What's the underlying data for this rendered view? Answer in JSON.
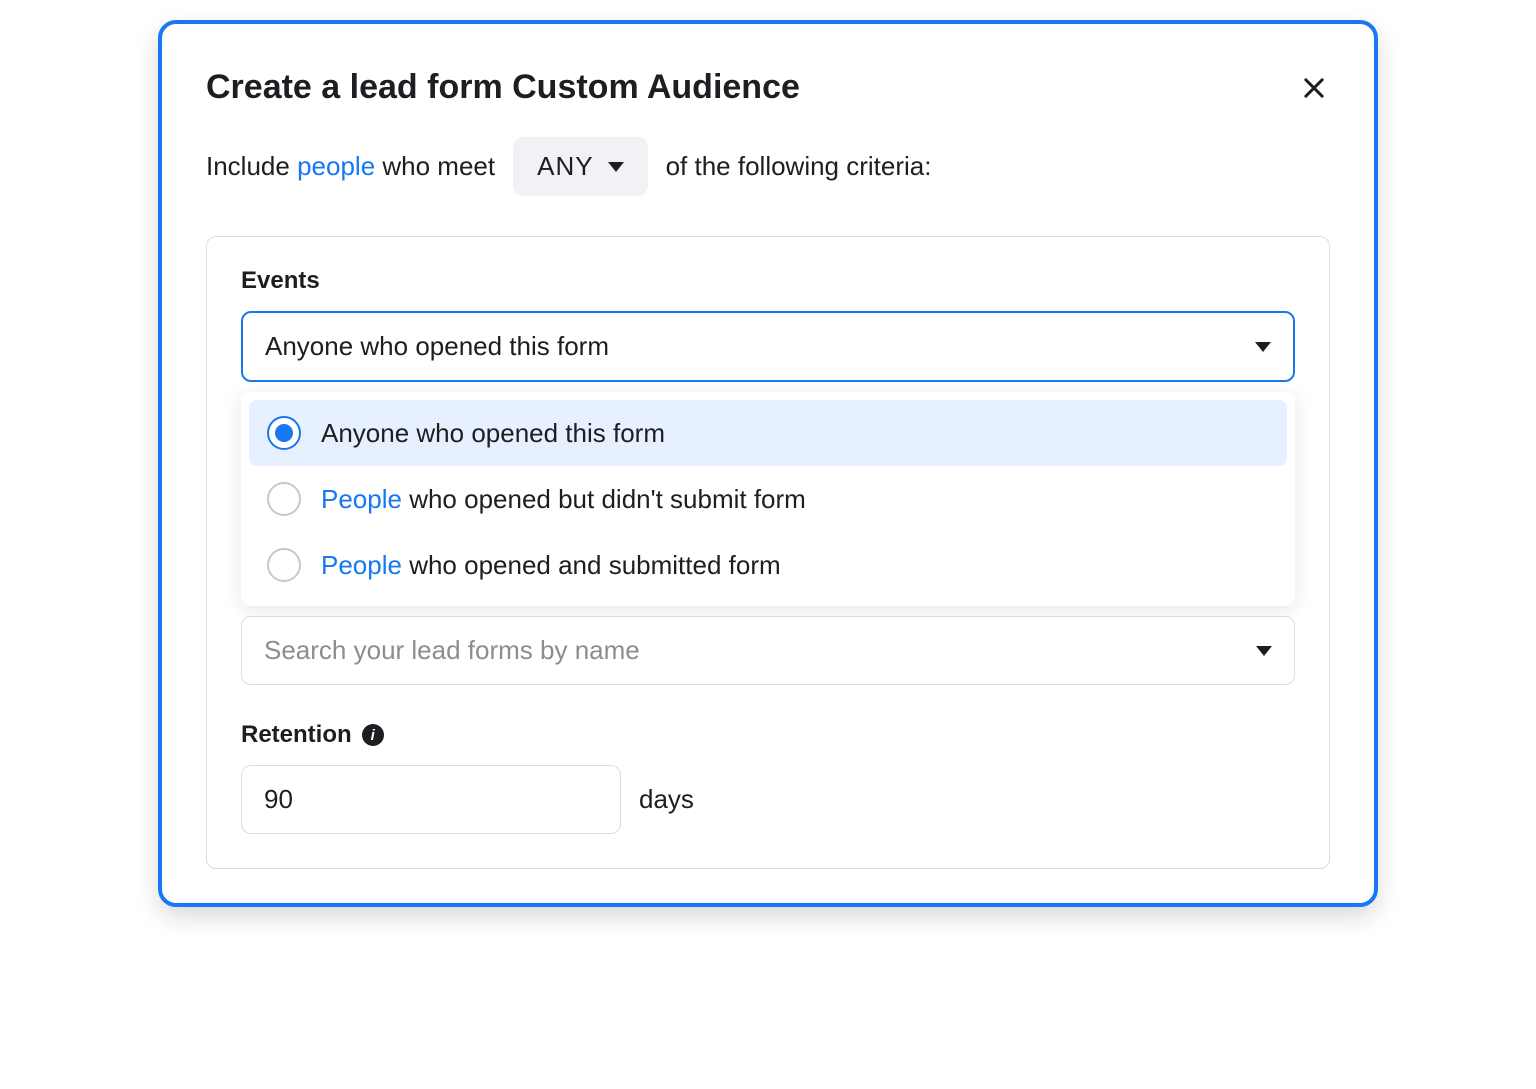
{
  "modal": {
    "title": "Create a lead form Custom Audience"
  },
  "criteria": {
    "prefix": "Include ",
    "people_link": "people",
    "middle": " who meet",
    "any_label": "ANY",
    "suffix": "of the following criteria:"
  },
  "events": {
    "label": "Events",
    "selected": "Anyone who opened this form",
    "options": [
      {
        "label": "Anyone who opened this form",
        "people_prefix": "",
        "rest": "Anyone who opened this form",
        "selected": true
      },
      {
        "label": "People who opened but didn't submit form",
        "people_prefix": "People",
        "rest": " who opened but didn't submit form",
        "selected": false
      },
      {
        "label": "People who opened and submitted form",
        "people_prefix": "People",
        "rest": " who opened and submitted form",
        "selected": false
      }
    ]
  },
  "lead_forms": {
    "placeholder": "Search your lead forms by name"
  },
  "retention": {
    "label": "Retention",
    "value": "90",
    "unit": "days"
  }
}
